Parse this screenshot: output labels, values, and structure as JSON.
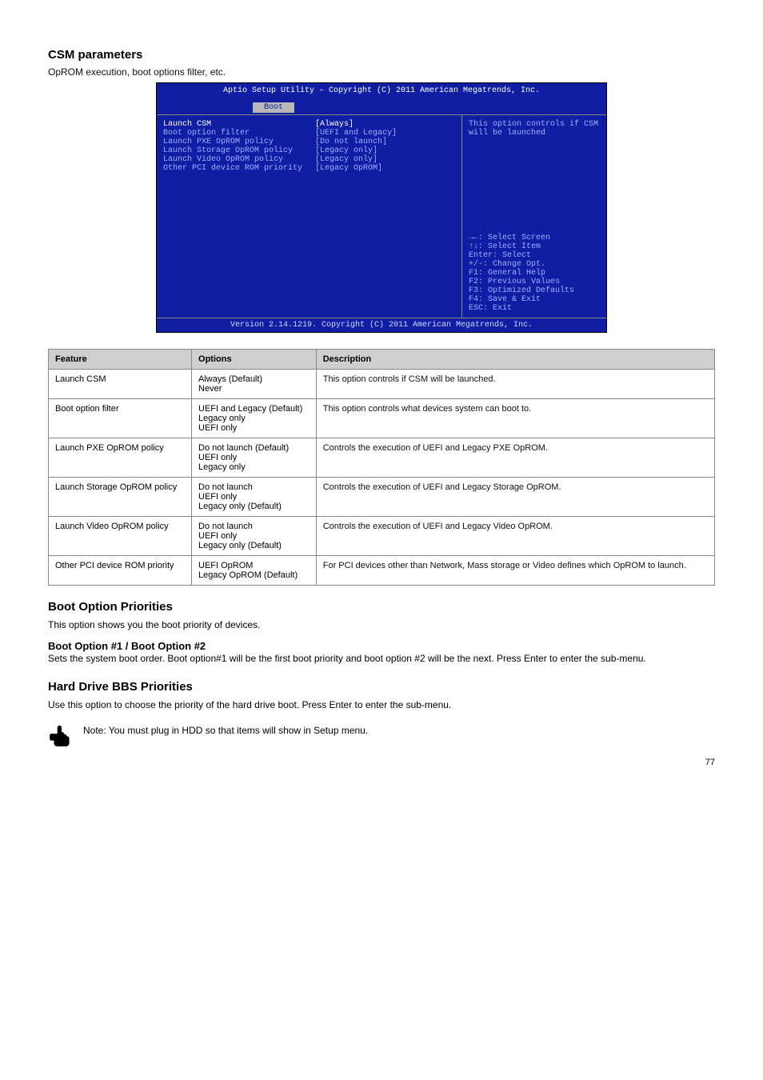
{
  "sections": {
    "csm_title": "CSM parameters",
    "csm_sub": "OpROM execution, boot options filter, etc."
  },
  "bios": {
    "title": "Aptio Setup Utility – Copyright (C) 2011 American Megatrends, Inc.",
    "tab": "Boot",
    "rows": [
      {
        "label": "Launch CSM",
        "value": "[Always]",
        "selected": true
      },
      {
        "label": "Boot option filter",
        "value": "[UEFI and Legacy]"
      },
      {
        "label": "Launch PXE OpROM policy",
        "value": "[Do not launch]"
      },
      {
        "label": "Launch Storage OpROM policy",
        "value": "[Legacy only]"
      },
      {
        "label": "Launch Video OpROM policy",
        "value": "[Legacy only]"
      },
      {
        "label": " ",
        "value": " "
      },
      {
        "label": "Other PCI device ROM priority",
        "value": "[Legacy OpROM]"
      }
    ],
    "help_desc": "This option controls if CSM will be launched",
    "help_keys": [
      "→←: Select Screen",
      "↑↓: Select Item",
      "Enter: Select",
      "+/-: Change Opt.",
      "F1: General Help",
      "F2: Previous Values",
      "F3: Optimized Defaults",
      "F4: Save & Exit",
      "ESC: Exit"
    ],
    "footer": "Version 2.14.1219. Copyright (C) 2011 American Megatrends, Inc."
  },
  "options_table": {
    "headers": [
      "Feature",
      "Options",
      "Description"
    ],
    "rows": [
      {
        "feature": "Launch CSM",
        "options": "Always (Default)\nNever",
        "description": "This option controls if CSM will be launched."
      },
      {
        "feature": "Boot option filter",
        "options": "UEFI and Legacy (Default)\nLegacy only\nUEFI only",
        "description": "This option controls what devices system can boot to."
      },
      {
        "feature": "Launch PXE OpROM policy",
        "options": "Do not launch (Default)\nUEFI only\nLegacy only",
        "description": "Controls the execution of UEFI and Legacy PXE OpROM."
      },
      {
        "feature": "Launch Storage OpROM policy",
        "options": "Do not launch\nUEFI only\nLegacy only (Default)",
        "description": "Controls the execution of UEFI and Legacy Storage OpROM."
      },
      {
        "feature": "Launch Video OpROM policy",
        "options": "Do not launch\nUEFI only\nLegacy only (Default)",
        "description": "Controls the execution of UEFI and Legacy Video OpROM."
      },
      {
        "feature": "Other PCI device ROM priority",
        "options": "UEFI OpROM\nLegacy OpROM (Default)",
        "description": "For PCI devices other than Network, Mass storage or Video defines which OpROM to launch."
      }
    ]
  },
  "boot_priorities": {
    "heading": "Boot Option Priorities",
    "p1": "This option shows you the boot priority of devices.",
    "sub1_title": "Boot Option #1 / Boot Option #2",
    "sub1_text": "Sets the system boot order. Boot option#1 will be the first boot priority and boot option #2 will be the next. Press Enter to enter the sub-menu."
  },
  "hdd_priorities": {
    "heading": "Hard Drive BBS Priorities",
    "p1": "Use this option to choose the priority of the hard drive boot. Press Enter to enter the sub-menu.",
    "note": "Note: You must plug in HDD so that items will show in Setup menu."
  },
  "page_number": "77"
}
